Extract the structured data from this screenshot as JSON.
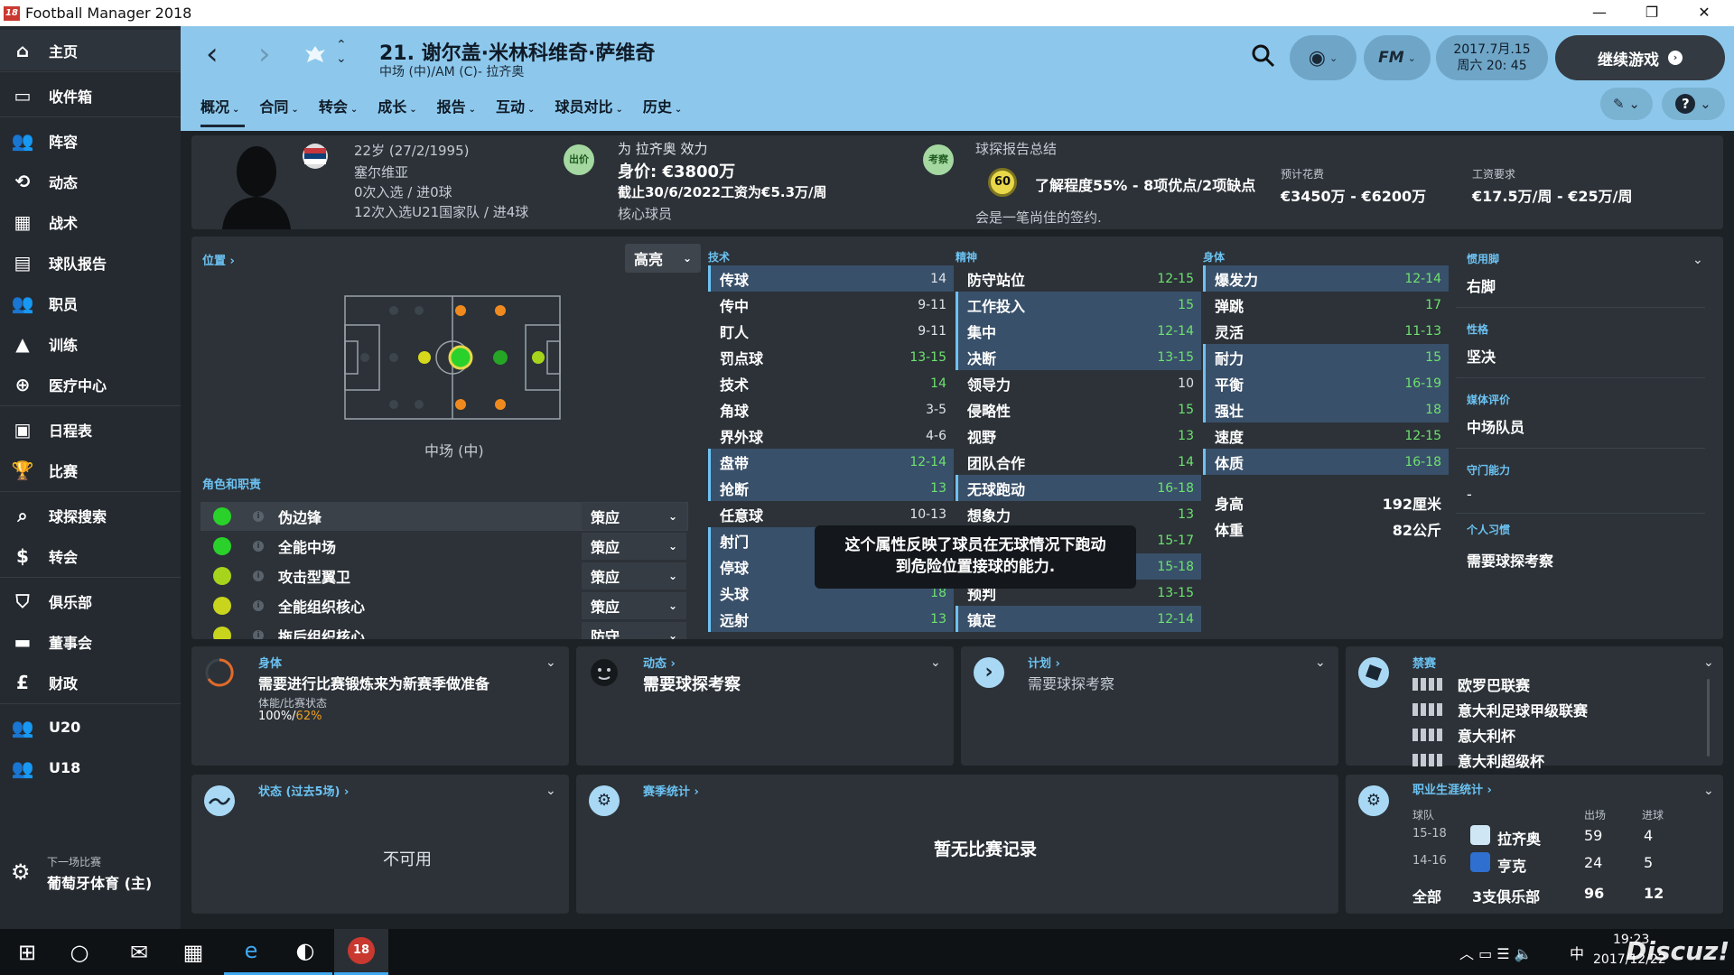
{
  "window": {
    "title": "Football Manager 2018",
    "logo": "18",
    "minimize": "—",
    "restore": "❐",
    "close": "✕"
  },
  "sidebar": {
    "items": [
      {
        "label": "主页",
        "icon": "home-icon"
      },
      {
        "label": "收件箱",
        "icon": "inbox-icon"
      },
      {
        "label": "阵容",
        "icon": "squad-icon"
      },
      {
        "label": "动态",
        "icon": "dynamics-icon"
      },
      {
        "label": "战术",
        "icon": "tactics-icon"
      },
      {
        "label": "球队报告",
        "icon": "report-icon"
      },
      {
        "label": "职员",
        "icon": "staff-icon"
      },
      {
        "label": "训练",
        "icon": "training-icon"
      },
      {
        "label": "医疗中心",
        "icon": "medical-icon"
      },
      {
        "label": "日程表",
        "icon": "calendar-icon"
      },
      {
        "label": "比赛",
        "icon": "trophy-icon"
      },
      {
        "label": "球探搜索",
        "icon": "search-icon"
      },
      {
        "label": "转会",
        "icon": "transfer-icon"
      },
      {
        "label": "俱乐部",
        "icon": "club-icon"
      },
      {
        "label": "董事会",
        "icon": "board-icon"
      },
      {
        "label": "财政",
        "icon": "finance-icon"
      },
      {
        "label": "U20",
        "icon": "u20-icon"
      },
      {
        "label": "U18",
        "icon": "u18-icon"
      }
    ],
    "next_match_label": "下一场比赛",
    "next_match_value": "葡萄牙体育 (主)"
  },
  "header": {
    "player_name": "21. 谢尔盖·米林科维奇·萨维奇",
    "player_sub": "中场 (中)/AM (C)- 拉齐奥",
    "date_line1": "2017.7月.15",
    "date_line2": "周六 20: 45",
    "continue_label": "继续游戏",
    "fm_label": "FM",
    "tabs": [
      "概况",
      "合同",
      "转会",
      "成长",
      "报告",
      "互动",
      "球员对比",
      "历史"
    ]
  },
  "player_info": {
    "age": "22岁 (27/2/1995)",
    "nation": "塞尔维亚",
    "caps": "0次入选 / 进0球",
    "u21_caps": "12次入选U21国家队 / 进4球",
    "status_badge": "出价",
    "plays_for": "为 拉齐奥 效力",
    "value": "身价: €3800万",
    "contract": "截止30/6/2022工资为€5.3万/周",
    "squad_status": "核心球员",
    "scout_badge": "考察",
    "scout_title": "球探报告总结",
    "scout_rating": "60",
    "scout_summary": "了解程度55% - 8项优点/2项缺点",
    "scout_comment": "会是一笔尚佳的签约.",
    "fee_label": "预计花费",
    "fee_value": "€3450万 - €6200万",
    "wage_label": "工资要求",
    "wage_value": "€17.5万/周 - €25万/周"
  },
  "positions": {
    "link_label": "位置",
    "highlight_label": "高亮",
    "position_label": "中场 (中)",
    "roles_label": "角色和职责"
  },
  "roles": [
    {
      "name": "伪边锋",
      "duty": "策应",
      "color": "#2ad12a"
    },
    {
      "name": "全能中场",
      "duty": "策应",
      "color": "#2ad12a"
    },
    {
      "name": "攻击型翼卫",
      "duty": "策应",
      "color": "#a6d41c"
    },
    {
      "name": "全能组织核心",
      "duty": "策应",
      "color": "#c9d51c"
    },
    {
      "name": "拖后组织核心",
      "duty": "防守",
      "color": "#c9d51c"
    }
  ],
  "attributes": {
    "technical_label": "技术",
    "mental_label": "精神",
    "physical_label": "身体",
    "technical": [
      {
        "n": "传球",
        "v": "14",
        "hl": true,
        "g": false
      },
      {
        "n": "传中",
        "v": "9-11",
        "hl": false,
        "g": false
      },
      {
        "n": "盯人",
        "v": "9-11",
        "hl": false,
        "g": false
      },
      {
        "n": "罚点球",
        "v": "13-15",
        "hl": false,
        "g": true
      },
      {
        "n": "技术",
        "v": "14",
        "hl": false,
        "g": true
      },
      {
        "n": "角球",
        "v": "3-5",
        "hl": false,
        "g": false
      },
      {
        "n": "界外球",
        "v": "4-6",
        "hl": false,
        "g": false
      },
      {
        "n": "盘带",
        "v": "12-14",
        "hl": true,
        "g": true
      },
      {
        "n": "抢断",
        "v": "13",
        "hl": true,
        "g": true
      },
      {
        "n": "任意球",
        "v": "10-13",
        "hl": false,
        "g": false
      },
      {
        "n": "射门",
        "v": "",
        "hl": true,
        "g": false
      },
      {
        "n": "停球",
        "v": "",
        "hl": true,
        "g": false
      },
      {
        "n": "头球",
        "v": "18",
        "hl": true,
        "g": true
      },
      {
        "n": "远射",
        "v": "13",
        "hl": true,
        "g": true
      }
    ],
    "mental": [
      {
        "n": "防守站位",
        "v": "12-15",
        "hl": false,
        "g": true
      },
      {
        "n": "工作投入",
        "v": "15",
        "hl": true,
        "g": true
      },
      {
        "n": "集中",
        "v": "12-14",
        "hl": true,
        "g": true
      },
      {
        "n": "决断",
        "v": "13-15",
        "hl": true,
        "g": true
      },
      {
        "n": "领导力",
        "v": "10",
        "hl": false,
        "g": false
      },
      {
        "n": "侵略性",
        "v": "15",
        "hl": false,
        "g": true
      },
      {
        "n": "视野",
        "v": "13",
        "hl": false,
        "g": true
      },
      {
        "n": "团队合作",
        "v": "14",
        "hl": false,
        "g": true
      },
      {
        "n": "无球跑动",
        "v": "16-18",
        "hl": true,
        "g": true
      },
      {
        "n": "想象力",
        "v": "13",
        "hl": false,
        "g": true
      },
      {
        "n": "",
        "v": "15-17",
        "hl": false,
        "g": true
      },
      {
        "n": "",
        "v": "15-18",
        "hl": true,
        "g": true
      },
      {
        "n": "预判",
        "v": "13-15",
        "hl": false,
        "g": true
      },
      {
        "n": "镇定",
        "v": "12-14",
        "hl": true,
        "g": true
      }
    ],
    "physical": [
      {
        "n": "爆发力",
        "v": "12-14",
        "hl": true,
        "g": true
      },
      {
        "n": "弹跳",
        "v": "17",
        "hl": false,
        "g": true
      },
      {
        "n": "灵活",
        "v": "11-13",
        "hl": false,
        "g": true
      },
      {
        "n": "耐力",
        "v": "15",
        "hl": true,
        "g": true
      },
      {
        "n": "平衡",
        "v": "16-19",
        "hl": true,
        "g": true
      },
      {
        "n": "强壮",
        "v": "18",
        "hl": true,
        "g": true
      },
      {
        "n": "速度",
        "v": "12-15",
        "hl": false,
        "g": true
      },
      {
        "n": "体质",
        "v": "16-18",
        "hl": true,
        "g": true
      }
    ],
    "height_label": "身高",
    "height_value": "192厘米",
    "weight_label": "体重",
    "weight_value": "82公斤"
  },
  "side_info": {
    "foot_label": "惯用脚",
    "foot_value": "右脚",
    "personality_label": "性格",
    "personality_value": "坚决",
    "media_label": "媒体评价",
    "media_value": "中场队员",
    "gk_label": "守门能力",
    "gk_value": "-",
    "habits_label": "个人习惯",
    "habits_value": "需要球探考察"
  },
  "tooltip": {
    "line1": "这个属性反映了球员在无球情况下跑动",
    "line2": "到危险位置接球的能力."
  },
  "bottom": {
    "physical_title": "身体",
    "physical_text": "需要进行比赛锻炼来为新赛季做准备",
    "fitness_label": "体能/比赛状态",
    "fitness_value": "100%/",
    "match_fitness": "62%",
    "dynamics_title": "动态",
    "dynamics_text": "需要球探考察",
    "plan_title": "计划",
    "plan_text": "需要球探考察",
    "bans_title": "禁赛",
    "bans": [
      "欧罗巴联赛",
      "意大利足球甲级联赛",
      "意大利杯",
      "意大利超级杯"
    ],
    "form_title": "状态 (过去5场)",
    "form_text": "不可用",
    "season_title": "赛季统计",
    "season_text": "暂无比赛记录",
    "career_title": "职业生涯统计",
    "career_headers": [
      "球队",
      "出场",
      "进球"
    ],
    "career_rows": [
      {
        "season": "15-18",
        "team": "拉齐奥",
        "apps": "59",
        "goals": "4"
      },
      {
        "season": "14-16",
        "team": "亨克",
        "apps": "24",
        "goals": "5"
      }
    ],
    "career_total": {
      "season": "全部",
      "team": "3支俱乐部",
      "apps": "96",
      "goals": "12"
    }
  },
  "taskbar": {
    "ime": "中",
    "time": "19:23",
    "date": "2017/12/22",
    "watermark": "Discuz!"
  }
}
